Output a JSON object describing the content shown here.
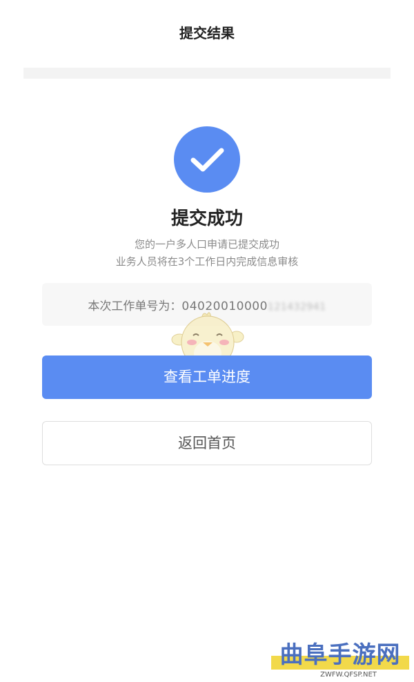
{
  "header": {
    "title": "提交结果"
  },
  "status": {
    "title": "提交成功",
    "desc_line1": "您的一户多人口申请已提交成功",
    "desc_line2": "业务人员将在3个工作日内完成信息审核",
    "accent": "#5a8cf2",
    "icon": "check-icon"
  },
  "order": {
    "label": "本次工作单号为：",
    "number_visible": "04020010000",
    "number_masked": "121432941"
  },
  "buttons": {
    "primary_label": "查看工单进度",
    "secondary_label": "返回首页"
  },
  "watermark": {
    "text": "曲阜手游网",
    "url": "ZWFW.QFSP.NET"
  }
}
